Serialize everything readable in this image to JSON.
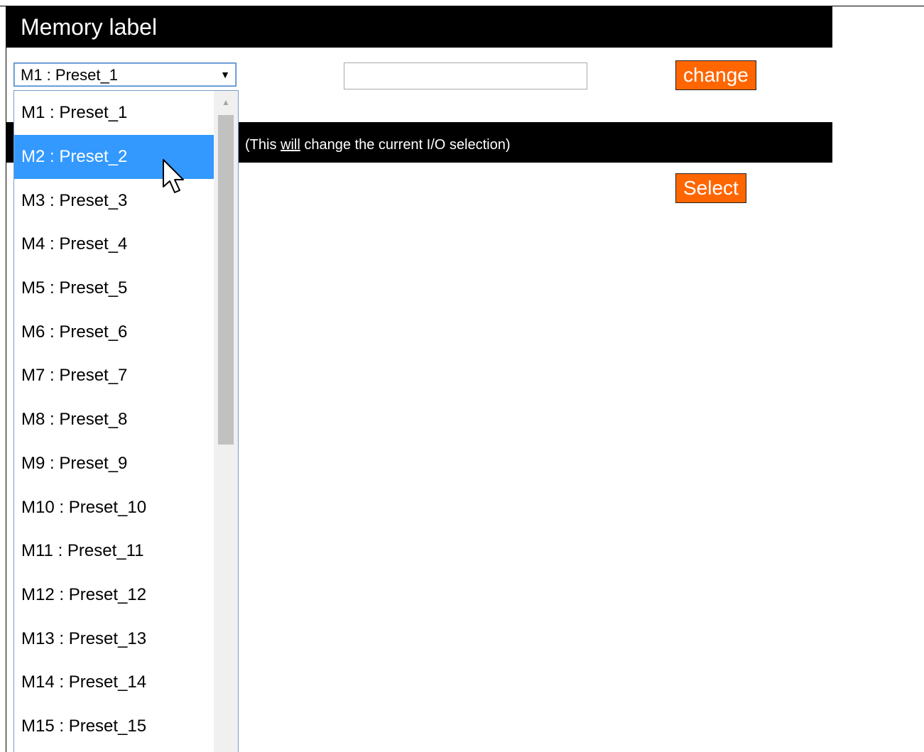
{
  "memory_label": {
    "title": "Memory label",
    "selected": "M1 : Preset_1",
    "input_value": "",
    "change_label": "change"
  },
  "select_section": {
    "note_prefix": "(This ",
    "note_emph": "will",
    "note_suffix": " change the current I/O selection)",
    "select_label": "Select"
  },
  "dropdown": {
    "highlighted_index": 1,
    "options": [
      "M1 : Preset_1",
      "M2 : Preset_2",
      "M3 : Preset_3",
      "M4 : Preset_4",
      "M5 : Preset_5",
      "M6 : Preset_6",
      "M7 : Preset_7",
      "M8 : Preset_8",
      "M9 : Preset_9",
      "M10 : Preset_10",
      "M11 : Preset_11",
      "M12 : Preset_12",
      "M13 : Preset_13",
      "M14 : Preset_14",
      "M15 : Preset_15"
    ]
  },
  "colors": {
    "accent_button": "#ff6600",
    "header_bg": "#000000",
    "highlight": "#3399ff"
  },
  "icons": {
    "select_arrow": "dropdown-arrow-icon",
    "scroll_up": "scroll-up-arrow-icon",
    "cursor": "mouse-pointer-icon"
  }
}
